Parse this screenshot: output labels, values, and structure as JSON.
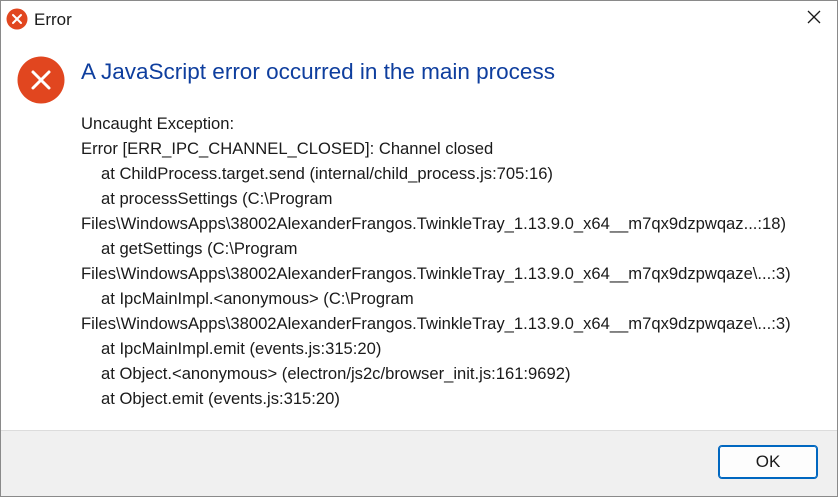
{
  "window": {
    "title": "Error",
    "title_icon": "error-icon",
    "close_icon": "close-icon"
  },
  "dialog": {
    "icon": "error-icon",
    "accent_color": "#e1461f",
    "main_instruction": "A JavaScript error occurred in the main process",
    "details": [
      {
        "text": "Uncaught Exception:",
        "indent": false
      },
      {
        "text": "Error [ERR_IPC_CHANNEL_CLOSED]: Channel closed",
        "indent": false
      },
      {
        "text": "at ChildProcess.target.send (internal/child_process.js:705:16)",
        "indent": true
      },
      {
        "text": "at processSettings (C:\\Program",
        "indent": true
      },
      {
        "text": "Files\\WindowsApps\\38002AlexanderFrangos.TwinkleTray_1.13.9.0_x64__m7qx9dzpwqaz...:18)",
        "indent": false
      },
      {
        "text": "at getSettings (C:\\Program",
        "indent": true
      },
      {
        "text": "Files\\WindowsApps\\38002AlexanderFrangos.TwinkleTray_1.13.9.0_x64__m7qx9dzpwqaze\\...:3)",
        "indent": false
      },
      {
        "text": "at IpcMainImpl.<anonymous> (C:\\Program",
        "indent": true
      },
      {
        "text": "Files\\WindowsApps\\38002AlexanderFrangos.TwinkleTray_1.13.9.0_x64__m7qx9dzpwqaze\\...:3)",
        "indent": false
      },
      {
        "text": "at IpcMainImpl.emit (events.js:315:20)",
        "indent": true
      },
      {
        "text": "at Object.<anonymous> (electron/js2c/browser_init.js:161:9692)",
        "indent": true
      },
      {
        "text": "at Object.emit (events.js:315:20)",
        "indent": true
      }
    ]
  },
  "footer": {
    "ok_label": "OK"
  }
}
